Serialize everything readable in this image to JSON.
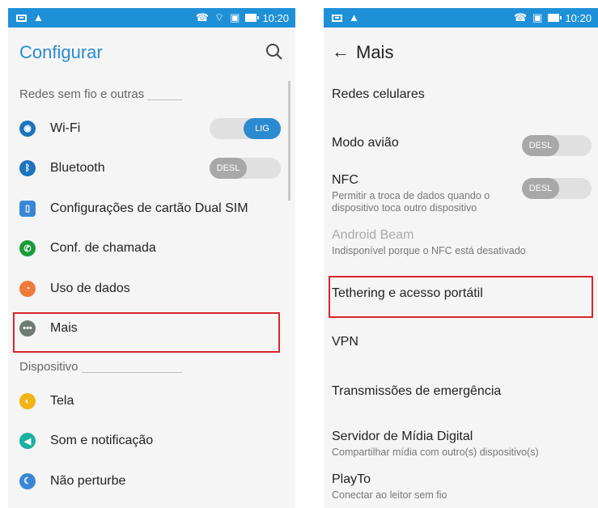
{
  "left": {
    "status": {
      "time": "10:20"
    },
    "title": "Configurar",
    "sections": [
      {
        "label": "Redes sem fio e outras",
        "items": [
          {
            "label": "Wi-Fi",
            "icon": "wifi-icon",
            "color": "#1e73be",
            "toggle": "LIG"
          },
          {
            "label": "Bluetooth",
            "icon": "bluetooth-icon",
            "color": "#1e73be",
            "toggle": "DESL"
          },
          {
            "label": "Configurações de cartão Dual SIM",
            "icon": "sim-card-icon",
            "color": "#3a86d6"
          },
          {
            "label": "Conf. de chamada",
            "icon": "phone-icon",
            "color": "#1a9b3a"
          },
          {
            "label": "Uso de dados",
            "icon": "data-usage-icon",
            "color": "#ee7b3a"
          },
          {
            "label": "Mais",
            "icon": "more-icon",
            "color": "#6f7b73"
          }
        ]
      },
      {
        "label": "Dispositivo",
        "items": [
          {
            "label": "Tela",
            "icon": "display-icon",
            "color": "#f2b316"
          },
          {
            "label": "Som e notificação",
            "icon": "sound-icon",
            "color": "#1ab0a0"
          },
          {
            "label": "Não perturbe",
            "icon": "moon-icon",
            "color": "#3a86d6"
          }
        ]
      }
    ]
  },
  "right": {
    "status": {
      "time": "10:20"
    },
    "title": "Mais",
    "items": [
      {
        "title": "Redes celulares"
      },
      {
        "title": "Modo avião",
        "toggle": "DESL"
      },
      {
        "title": "NFC",
        "sub": "Permitir a troca de dados quando o dispositivo toca outro dispositivo",
        "toggle": "DESL"
      },
      {
        "title": "Android Beam",
        "sub": "Indisponível porque o NFC está desativado",
        "disabled": true
      },
      {
        "title": "Tethering e acesso portátil"
      },
      {
        "title": "VPN"
      },
      {
        "title": "Transmissões de emergência"
      },
      {
        "title": "Servidor de Mídia Digital",
        "sub": "Compartilhar mídia com outro(s) dispositivo(s)"
      },
      {
        "title": "PlayTo",
        "sub": "Conectar ao leitor sem fio"
      }
    ]
  },
  "colors": {
    "accent": "#2b8bd1",
    "statusbar": "#1e90d8",
    "highlight": "#d9262c"
  }
}
